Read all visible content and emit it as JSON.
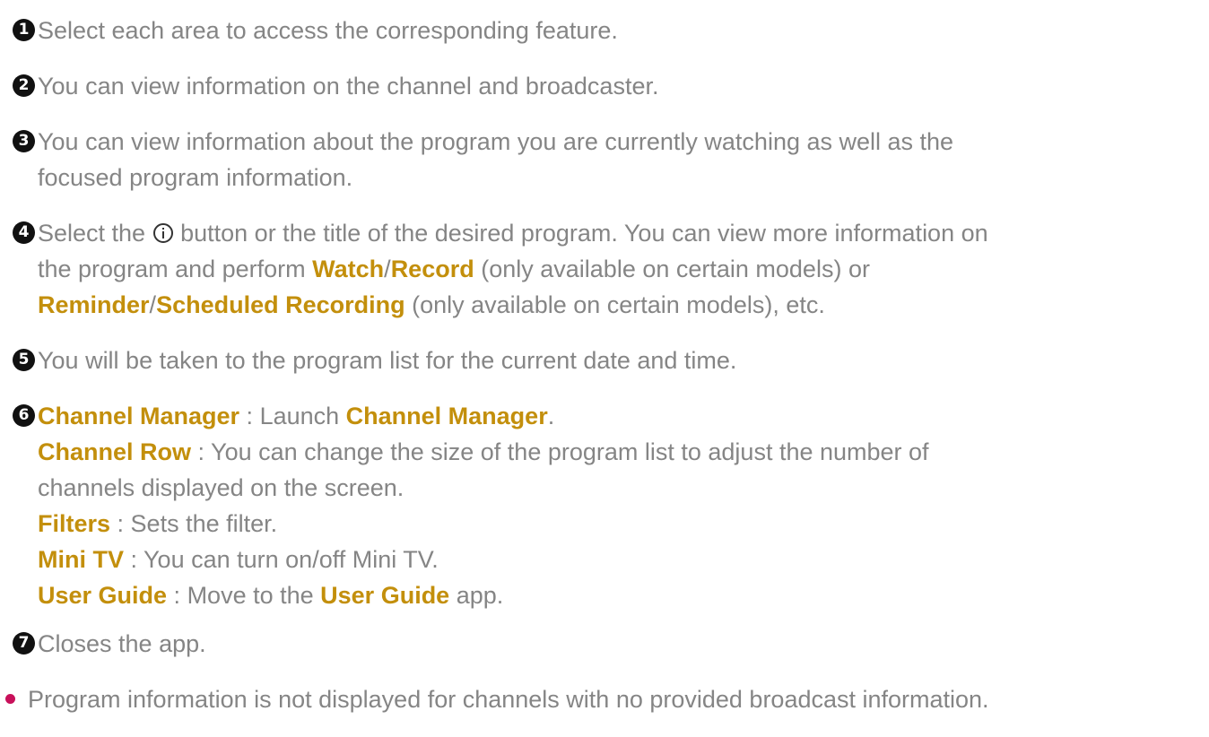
{
  "items": [
    {
      "num": "1",
      "parts": [
        {
          "t": "Select each area to access the corresponding feature."
        }
      ]
    },
    {
      "num": "2",
      "parts": [
        {
          "t": "You can view information on the channel and broadcaster."
        }
      ]
    },
    {
      "num": "3",
      "line1": "You can view information about the program you are currently watching as well as the",
      "line2": "focused program information."
    },
    {
      "num": "4",
      "line1a": "Select the",
      "line1b": "button or the title of the desired program. You can view more information on",
      "line2a": "the program and perform",
      "watch": "Watch",
      "slash": "/",
      "record": "Record",
      "line2b": "(only available on certain models) or",
      "reminder": "Reminder",
      "scheduled": "Scheduled Recording",
      "line3b": "(only available on certain models), etc."
    },
    {
      "num": "5",
      "parts": [
        {
          "t": "You will be taken to the program list for the current date and time."
        }
      ]
    },
    {
      "num": "6",
      "entries": [
        {
          "kw": "Channel Manager",
          "sep": " : ",
          "text": "Launch ",
          "kw2": "Channel Manager",
          "tail": "."
        },
        {
          "kw": "Channel Row",
          "sep": " : ",
          "text": "You can change the size of the program list to adjust the number of",
          "cont": "channels displayed on the screen."
        },
        {
          "kw": "Filters",
          "sep": " : ",
          "text": "Sets the filter."
        },
        {
          "kw": "Mini TV",
          "sep": " : ",
          "text": "You can turn on/off Mini TV."
        },
        {
          "kw": "User Guide",
          "sep": " : ",
          "text": "Move to the ",
          "kw2": "User Guide",
          "tail": " app."
        }
      ]
    },
    {
      "num": "7",
      "parts": [
        {
          "t": "Closes the app."
        }
      ]
    }
  ],
  "note": "Program information is not displayed for channels with no provided broadcast information.",
  "colors": {
    "text": "#858585",
    "keyword": "#c38f0c",
    "bullet": "#c8105a",
    "number_badge": "#111111"
  },
  "icons": {
    "info_button": "info-circle-icon"
  }
}
